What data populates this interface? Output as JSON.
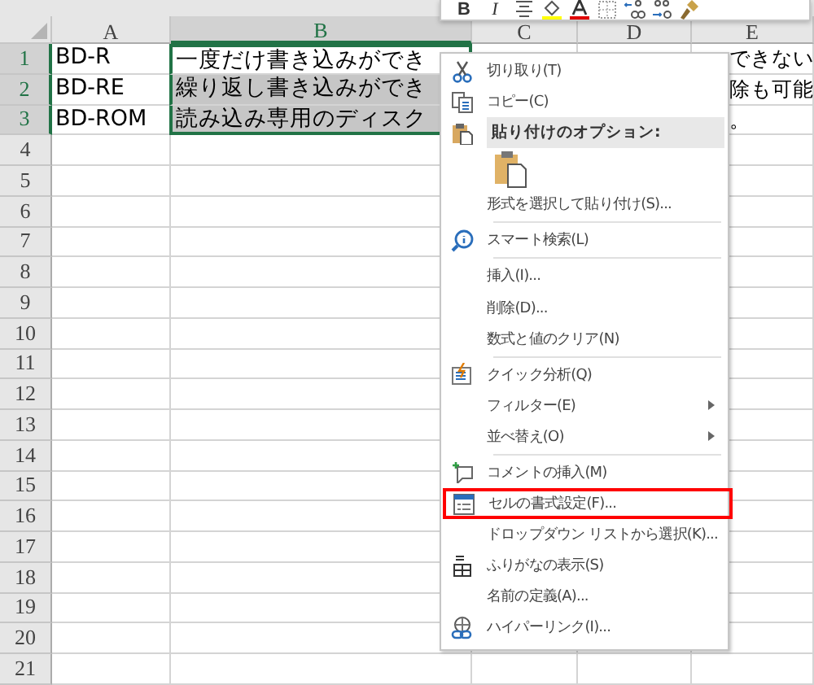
{
  "toolbar": {
    "buttons": [
      {
        "kind": "bold",
        "label": "B"
      },
      {
        "kind": "italic",
        "label": "I"
      },
      {
        "kind": "align"
      },
      {
        "kind": "fill"
      },
      {
        "kind": "font-color"
      },
      {
        "kind": "border"
      },
      {
        "kind": "inc-decimal"
      },
      {
        "kind": "dec-decimal"
      },
      {
        "kind": "brush"
      }
    ]
  },
  "sheet": {
    "columns": [
      {
        "label": "A",
        "selected": false
      },
      {
        "label": "B",
        "selected": true
      },
      {
        "label": "C",
        "selected": false
      },
      {
        "label": "D",
        "selected": false
      },
      {
        "label": "E",
        "selected": false
      }
    ],
    "rows": [
      {
        "number": "1",
        "selected": true,
        "cells": [
          {
            "text": "BD-R",
            "selected": false
          },
          {
            "text": "一度だけ書き込みができ",
            "selected": true,
            "active": true
          }
        ],
        "overflow": "できない"
      },
      {
        "number": "2",
        "selected": true,
        "cells": [
          {
            "text": "BD-RE",
            "selected": false
          },
          {
            "text": "繰り返し書き込みができ",
            "selected": true,
            "active": false
          }
        ],
        "overflow": "除も可能"
      },
      {
        "number": "3",
        "selected": true,
        "cells": [
          {
            "text": "BD-ROM",
            "selected": false
          },
          {
            "text": "読み込み専用のディスク",
            "selected": true,
            "active": false
          }
        ],
        "overflow": "。"
      },
      {
        "number": "4",
        "selected": false,
        "cells": []
      },
      {
        "number": "5",
        "selected": false,
        "cells": []
      },
      {
        "number": "6",
        "selected": false,
        "cells": []
      },
      {
        "number": "7",
        "selected": false,
        "cells": []
      },
      {
        "number": "8",
        "selected": false,
        "cells": []
      },
      {
        "number": "9",
        "selected": false,
        "cells": []
      },
      {
        "number": "10",
        "selected": false,
        "cells": []
      },
      {
        "number": "11",
        "selected": false,
        "cells": []
      },
      {
        "number": "12",
        "selected": false,
        "cells": []
      },
      {
        "number": "13",
        "selected": false,
        "cells": []
      },
      {
        "number": "14",
        "selected": false,
        "cells": []
      },
      {
        "number": "15",
        "selected": false,
        "cells": []
      },
      {
        "number": "16",
        "selected": false,
        "cells": []
      },
      {
        "number": "17",
        "selected": false,
        "cells": []
      },
      {
        "number": "18",
        "selected": false,
        "cells": []
      },
      {
        "number": "19",
        "selected": false,
        "cells": []
      },
      {
        "number": "20",
        "selected": false,
        "cells": []
      },
      {
        "number": "21",
        "selected": false,
        "cells": []
      }
    ]
  },
  "context_menu": {
    "items": [
      {
        "kind": "item",
        "label": "切り取り(T)",
        "highlighted": false
      },
      {
        "kind": "item",
        "label": "コピー(C)",
        "highlighted": false
      },
      {
        "kind": "header",
        "label": "貼り付けのオプション:"
      },
      {
        "kind": "paste-options"
      },
      {
        "kind": "item",
        "label": "形式を選択して貼り付け(S)...",
        "highlighted": false
      },
      {
        "kind": "separator"
      },
      {
        "kind": "item",
        "label": "スマート検索(L)",
        "highlighted": false
      },
      {
        "kind": "separator"
      },
      {
        "kind": "item",
        "label": "挿入(I)...",
        "highlighted": false
      },
      {
        "kind": "item",
        "label": "削除(D)...",
        "highlighted": false
      },
      {
        "kind": "item",
        "label": "数式と値のクリア(N)",
        "highlighted": false
      },
      {
        "kind": "separator"
      },
      {
        "kind": "item",
        "label": "クイック分析(Q)",
        "highlighted": false
      },
      {
        "kind": "item",
        "label": "フィルター(E)",
        "highlighted": false,
        "submenu": true
      },
      {
        "kind": "item",
        "label": "並べ替え(O)",
        "highlighted": false,
        "submenu": true
      },
      {
        "kind": "separator"
      },
      {
        "kind": "item",
        "label": "コメントの挿入(M)",
        "highlighted": false
      },
      {
        "kind": "item",
        "label": "セルの書式設定(F)...",
        "highlighted": true
      },
      {
        "kind": "item",
        "label": "ドロップダウン リストから選択(K)...",
        "highlighted": false
      },
      {
        "kind": "item",
        "label": "ふりがなの表示(S)",
        "highlighted": false
      },
      {
        "kind": "item",
        "label": "名前の定義(A)...",
        "highlighted": false
      },
      {
        "kind": "item",
        "label": "ハイパーリンク(I)...",
        "highlighted": false
      }
    ]
  }
}
